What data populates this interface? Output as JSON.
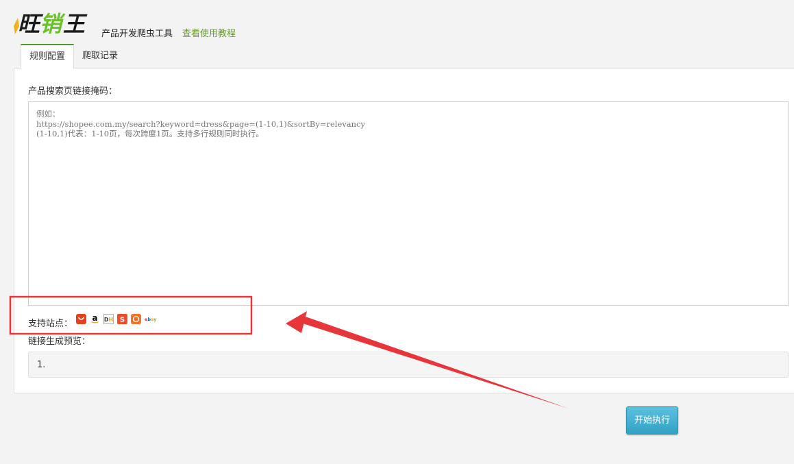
{
  "header": {
    "logo_text": "旺销王",
    "app_title": "产品开发爬虫工具",
    "tutorial_link": "查看使用教程"
  },
  "tabs": [
    {
      "label": "规则配置",
      "active": true
    },
    {
      "label": "爬取记录",
      "active": false
    }
  ],
  "form": {
    "url_label": "产品搜索页链接掩码：",
    "url_placeholder": "例如：\nhttps://shopee.com.my/search?keyword=dress&page=(1-10,1)&sortBy=relevancy\n(1-10,1)代表：1-10页，每次跨度1页。支持多行规则同时执行。",
    "url_value": "",
    "sites_label": "支持站点：",
    "sites": [
      {
        "icon": "aliexpress-icon",
        "color": "#e8401c"
      },
      {
        "icon": "amazon-icon",
        "color": "#111111"
      },
      {
        "icon": "dhgate-icon",
        "color": "#e8a317"
      },
      {
        "icon": "shopee-icon",
        "color": "#ee4d2d"
      },
      {
        "icon": "lazada-icon",
        "color": "#f57224"
      },
      {
        "icon": "ebay-icon",
        "color": "#e53238"
      }
    ],
    "preview_label": "链接生成预览：",
    "preview_text": "1."
  },
  "actions": {
    "run_label": "开始执行",
    "run_color": "#5bc0de"
  },
  "colors": {
    "accent": "#4f9a2b",
    "annotation": "#e8353a"
  }
}
